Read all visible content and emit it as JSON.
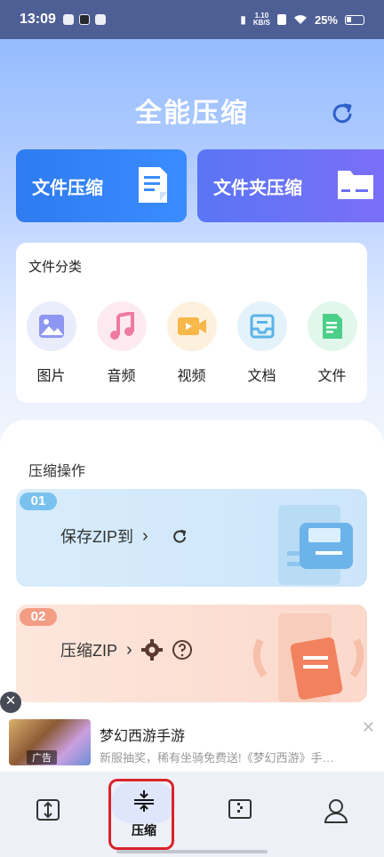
{
  "status": {
    "time": "13:09",
    "net_speed_value": "1.10",
    "net_speed_unit": "KB/S",
    "battery": "25%"
  },
  "header": {
    "title": "全能压缩"
  },
  "quick_actions": {
    "file_compress": "文件压缩",
    "folder_compress": "文件夹压缩"
  },
  "categories": {
    "title": "文件分类",
    "items": [
      {
        "label": "图片",
        "icon": "image-icon",
        "bg": "#e9ecfb"
      },
      {
        "label": "音频",
        "icon": "music-icon",
        "bg": "#fdeaf0"
      },
      {
        "label": "视频",
        "icon": "video-icon",
        "bg": "#fdf1de"
      },
      {
        "label": "文档",
        "icon": "inbox-icon",
        "bg": "#e4f2fb"
      },
      {
        "label": "文件",
        "icon": "file-icon",
        "bg": "#e2f7ec"
      }
    ]
  },
  "operations": {
    "title": "压缩操作",
    "items": [
      {
        "badge": "01",
        "label": "保存ZIP到"
      },
      {
        "badge": "02",
        "label": "压缩ZIP"
      }
    ]
  },
  "ad": {
    "title": "梦幻西游手游",
    "description": "新服抽奖，稀有坐骑免费送!《梦幻西游》手…",
    "tag": "广告"
  },
  "tabbar": {
    "compress_label": "压缩"
  },
  "colors": {
    "primary": "#3a8cff",
    "accent": "#7b6ff7",
    "highlight": "#d9232a"
  }
}
